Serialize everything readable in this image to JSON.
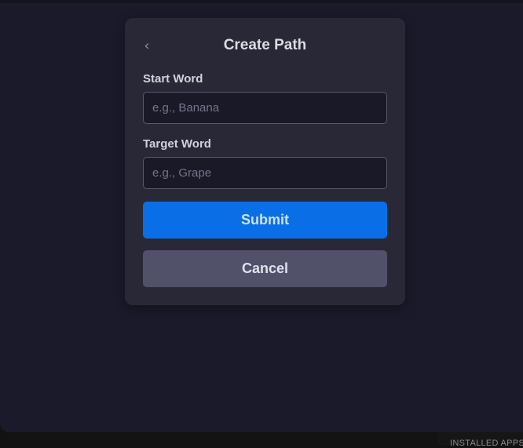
{
  "dialog": {
    "title": "Create Path",
    "back_icon": "chevron-left-icon",
    "back_glyph": "‹"
  },
  "form": {
    "start_word": {
      "label": "Start Word",
      "value": "",
      "placeholder": "e.g., Banana"
    },
    "target_word": {
      "label": "Target Word",
      "value": "",
      "placeholder": "e.g., Grape"
    }
  },
  "actions": {
    "submit_label": "Submit",
    "cancel_label": "Cancel"
  },
  "taskbar": {
    "installed_apps_label": "INSTALLED APPS"
  },
  "colors": {
    "accent": "#0a6fe6",
    "background": "#1a1a2b",
    "card": "#282836",
    "cancel_button": "#51516a"
  }
}
